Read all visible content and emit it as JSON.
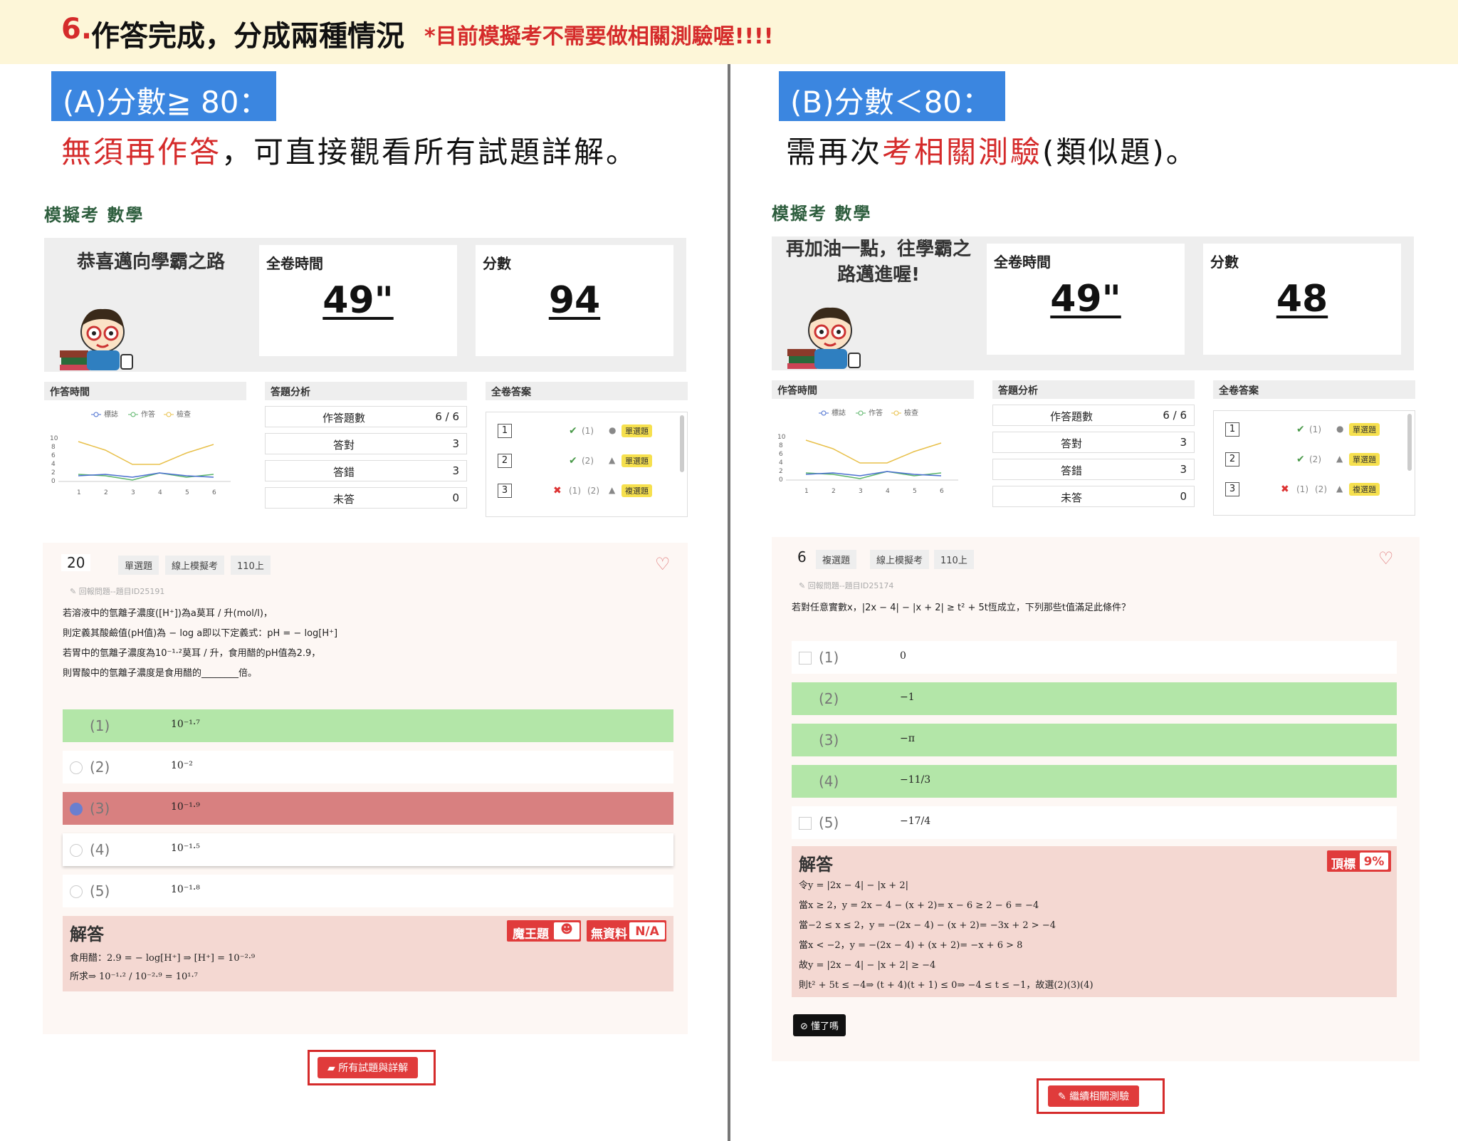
{
  "header": {
    "number": "6.",
    "title": "作答完成，分成兩種情況",
    "note": "*目前模擬考不需要做相關測驗喔!!!!"
  },
  "left": {
    "tag": "(A)分數≧ 80：",
    "sub_red": "無須再作答",
    "sub_rest": "，可直接觀看所有試題詳解。",
    "panel_title": "模擬考 數學",
    "message": "恭喜邁向學霸之路",
    "time_label": "全卷時間",
    "time_value": "49\"",
    "score_label": "分數",
    "score_value": "94",
    "chart_label": "作答時間",
    "analysis_label": "答題分析",
    "answers_label": "全卷答案",
    "legend": [
      "標誌",
      "作答",
      "檢查"
    ],
    "analysis": [
      {
        "label": "作答題數",
        "value": "6 / 6"
      },
      {
        "label": "答對",
        "value": "3"
      },
      {
        "label": "答錯",
        "value": "3"
      },
      {
        "label": "未答",
        "value": "0"
      }
    ],
    "answers": [
      {
        "n": "1",
        "t1": "(1)",
        "badge": "單選題"
      },
      {
        "n": "2",
        "t1": "(2)",
        "badge": "單選題"
      },
      {
        "n": "3",
        "t1": "(1)",
        "t2": "(2)",
        "badge": "複選題"
      }
    ],
    "q": {
      "num": "20",
      "type": "單選題",
      "source": "線上模擬考",
      "term": "110上",
      "report": "回報問題--題目ID25191",
      "lines": [
        "若溶液中的氫離子濃度([H⁺])為a莫耳 / 升(mol/l)，",
        "則定義其酸鹼值(pH值)為 − log a即以下定義式：pH = − log[H⁺]",
        "若胃中的氫離子濃度為10⁻¹·²莫耳 / 升，食用醋的pH值為2.9，",
        "則胃酸中的氫離子濃度是食用醋的________倍。"
      ],
      "options": [
        {
          "label": "(1)",
          "value": "10⁻¹·⁷"
        },
        {
          "label": "(2)",
          "value": "10⁻²"
        },
        {
          "label": "(3)",
          "value": "10⁻¹·⁹"
        },
        {
          "label": "(4)",
          "value": "10⁻¹·⁵"
        },
        {
          "label": "(5)",
          "value": "10⁻¹·⁸"
        }
      ],
      "solution_title": "解答",
      "solution": [
        "食用醋：2.9 = − log[H⁺] ⇒ [H⁺] = 10⁻²·⁹",
        "所求⇒ 10⁻¹·² / 10⁻²·⁹ = 10¹·⁷"
      ],
      "badge1": "魔王題",
      "badge2": "無資料",
      "badge2_value": "N/A"
    },
    "button": "所有試題與詳解"
  },
  "right": {
    "tag": "(B)分數＜80：",
    "sub_a": "需再次",
    "sub_red": "考相關測驗",
    "sub_b": "(類似題)。",
    "panel_title": "模擬考 數學",
    "message": "再加油一點，往學霸之路邁進喔!",
    "time_label": "全卷時間",
    "time_value": "49\"",
    "score_label": "分數",
    "score_value": "48",
    "chart_label": "作答時間",
    "analysis_label": "答題分析",
    "answers_label": "全卷答案",
    "legend": [
      "標誌",
      "作答",
      "檢查"
    ],
    "analysis": [
      {
        "label": "作答題數",
        "value": "6 / 6"
      },
      {
        "label": "答對",
        "value": "3"
      },
      {
        "label": "答錯",
        "value": "3"
      },
      {
        "label": "未答",
        "value": "0"
      }
    ],
    "answers": [
      {
        "n": "1",
        "t1": "(1)",
        "badge": "單選題"
      },
      {
        "n": "2",
        "t1": "(2)",
        "badge": "單選題"
      },
      {
        "n": "3",
        "t1": "(1)",
        "t2": "(2)",
        "badge": "複選題"
      }
    ],
    "q": {
      "num": "6",
      "type": "複選題",
      "source": "線上模擬考",
      "term": "110上",
      "report": "回報問題--題目ID25174",
      "line": "若對任意實數x，|2x − 4| − |x + 2| ≥ t² + 5t恆成立，下列那些t值滿足此條件？",
      "options": [
        {
          "label": "(1)",
          "value": "0"
        },
        {
          "label": "(2)",
          "value": "−1"
        },
        {
          "label": "(3)",
          "value": "−π"
        },
        {
          "label": "(4)",
          "value": "−11/3"
        },
        {
          "label": "(5)",
          "value": "−17/4"
        }
      ],
      "solution_title": "解答",
      "solution": [
        "令y = |2x − 4| − |x + 2|",
        "當x ≥ 2，y = 2x − 4 − (x + 2)= x − 6 ≥ 2 − 6 = −4",
        "當−2 ≤ x ≤ 2，y = −(2x − 4) − (x + 2)= −3x + 2 > −4",
        "當x < −2，y = −(2x − 4) + (x + 2)= −x + 6 > 8",
        "故y = |2x − 4| − |x + 2| ≥ −4",
        "則t² + 5t ≤ −4⇒ (t + 4)(t + 1) ≤ 0⇒ −4 ≤ t ≤ −1，故選(2)(3)(4)"
      ],
      "badge": "頂標",
      "badge_value": "9%",
      "help": "懂了嗎"
    },
    "button": "繼續相關測驗"
  }
}
